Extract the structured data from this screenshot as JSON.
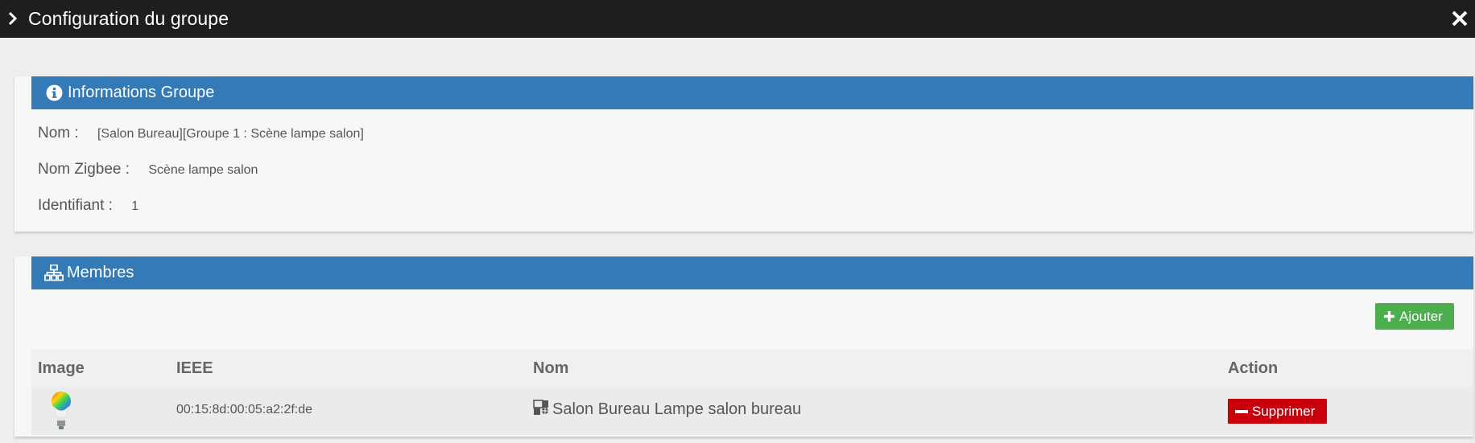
{
  "modal": {
    "title": "Configuration du groupe",
    "chevron_icon": "chevron-right-icon",
    "close_icon": "close-icon"
  },
  "info_panel": {
    "title": "Informations Groupe",
    "icon": "info-circle-icon",
    "fields": [
      {
        "label": "Nom :",
        "value": "[Salon Bureau][Groupe 1 : Scène lampe salon]"
      },
      {
        "label": "Nom Zigbee :",
        "value": "Scène lampe salon"
      },
      {
        "label": "Identifiant :",
        "value": "1"
      }
    ]
  },
  "members_panel": {
    "title": "Membres",
    "icon": "sitemap-icon",
    "add_button": "Ajouter",
    "columns": [
      "Image",
      "IEEE",
      "Nom",
      "Action"
    ],
    "rows": [
      {
        "image": "light-bulb-icon",
        "ieee": "00:15:8d:00:05:a2:2f:de",
        "name": "Salon Bureau Lampe salon bureau",
        "action": "Supprimer"
      }
    ]
  },
  "colors": {
    "titlebar": "#1e1e1e",
    "panel_header": "#337ab7",
    "add_button": "#4cae4c",
    "delete_button": "#c9000b"
  }
}
